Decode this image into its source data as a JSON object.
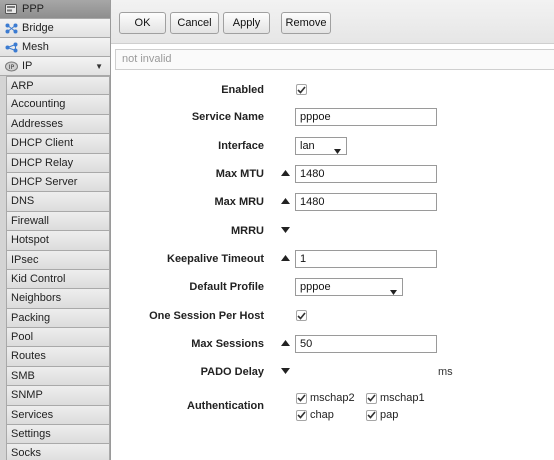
{
  "sidebar": {
    "top_items": [
      {
        "label": "PPP",
        "icon": "ppp-icon",
        "active": true
      },
      {
        "label": "Bridge",
        "icon": "bridge-icon"
      },
      {
        "label": "Mesh",
        "icon": "mesh-icon"
      },
      {
        "label": "IP",
        "icon": "ip-icon",
        "expanded": true
      }
    ],
    "ip_sub_items": [
      "ARP",
      "Accounting",
      "Addresses",
      "DHCP Client",
      "DHCP Relay",
      "DHCP Server",
      "DNS",
      "Firewall",
      "Hotspot",
      "IPsec",
      "Kid Control",
      "Neighbors",
      "Packing",
      "Pool",
      "Routes",
      "SMB",
      "SNMP",
      "Services",
      "Settings",
      "Socks"
    ]
  },
  "toolbar": {
    "ok_label": "OK",
    "cancel_label": "Cancel",
    "apply_label": "Apply",
    "remove_label": "Remove"
  },
  "status": {
    "text": "not invalid"
  },
  "form": {
    "enabled": {
      "label": "Enabled",
      "checked": true
    },
    "service_name": {
      "label": "Service Name",
      "value": "pppoe"
    },
    "interface": {
      "label": "Interface",
      "value": "lan"
    },
    "max_mtu": {
      "label": "Max MTU",
      "value": "1480"
    },
    "max_mru": {
      "label": "Max MRU",
      "value": "1480"
    },
    "mrru": {
      "label": "MRRU"
    },
    "keepalive_timeout": {
      "label": "Keepalive Timeout",
      "value": "1"
    },
    "default_profile": {
      "label": "Default Profile",
      "value": "pppoe"
    },
    "one_session_per_host": {
      "label": "One Session Per Host",
      "checked": true
    },
    "max_sessions": {
      "label": "Max Sessions",
      "value": "50"
    },
    "pado_delay": {
      "label": "PADO Delay",
      "unit": "ms"
    },
    "authentication": {
      "label": "Authentication",
      "options": [
        {
          "label": "mschap2",
          "checked": true
        },
        {
          "label": "mschap1",
          "checked": true
        },
        {
          "label": "chap",
          "checked": true
        },
        {
          "label": "pap",
          "checked": true
        }
      ]
    }
  },
  "colors": {
    "sidebar_bg": "#d4d4d4",
    "active_item": "#9a9a9a",
    "toolbar_bg": "#ececec",
    "status_text": "#9a9a9a"
  }
}
